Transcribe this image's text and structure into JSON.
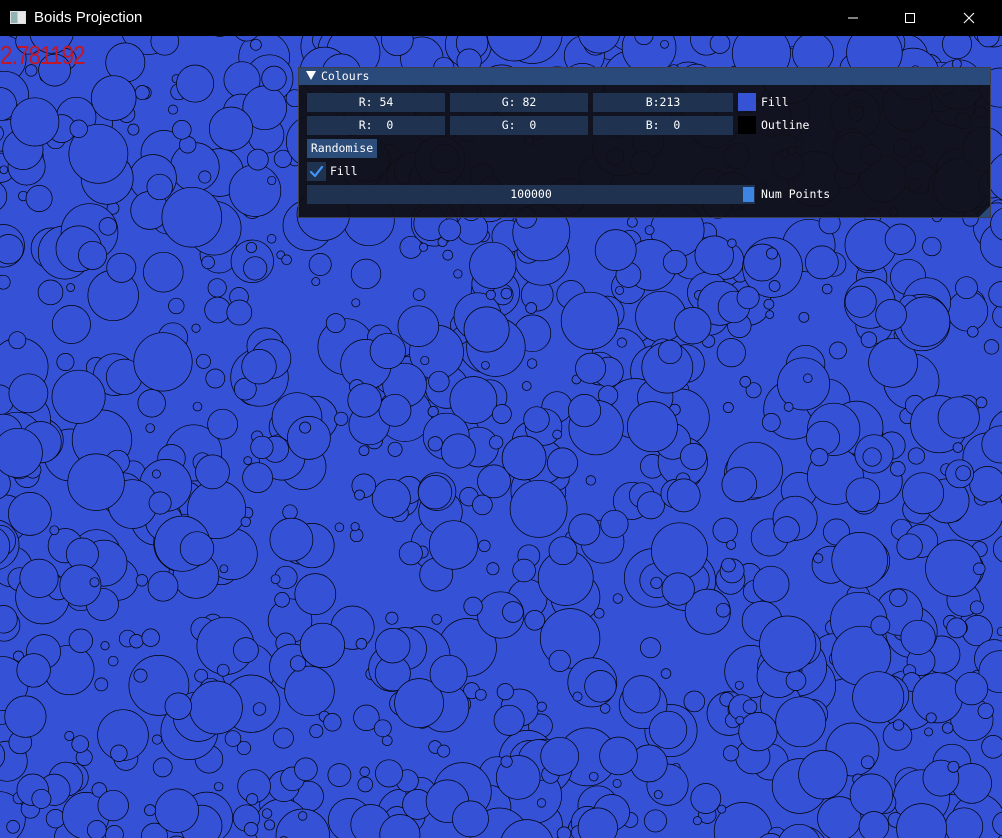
{
  "window": {
    "title": "Boids Projection",
    "icon": "app-window-icon",
    "controls": {
      "minimize_icon": "minimize-icon",
      "maximize_icon": "maximize-icon",
      "close_icon": "close-icon"
    }
  },
  "canvas": {
    "background_color": "#3551d5",
    "outline_color": "#000000",
    "fps": "2.781192",
    "fps_color": "#c0182a"
  },
  "panel": {
    "title": "Colours",
    "fill_row": {
      "r": "R: 54",
      "g": "G: 82",
      "b": "B:213",
      "swatch_color": "#3652d5",
      "label": "Fill"
    },
    "outline_row": {
      "r": "R:  0",
      "g": "G:  0",
      "b": "B:  0",
      "swatch_color": "#000000",
      "label": "Outline"
    },
    "randomise_label": "Randomise",
    "fill_checkbox": {
      "checked": true,
      "label": "Fill"
    },
    "num_points": {
      "value": "100000",
      "label": "Num Points"
    }
  }
}
